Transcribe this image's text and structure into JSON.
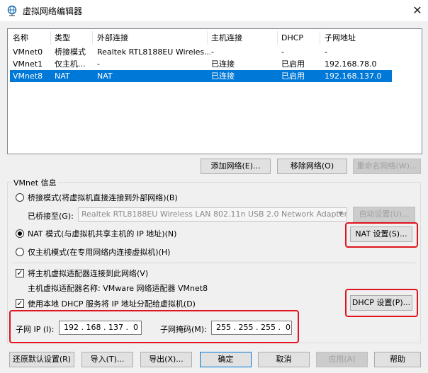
{
  "window": {
    "title": "虚拟网络编辑器",
    "close_symbol": "✕"
  },
  "table": {
    "headers": [
      "名称",
      "类型",
      "外部连接",
      "主机连接",
      "DHCP",
      "子网地址"
    ],
    "rows": [
      [
        "VMnet0",
        "桥接模式",
        "Realtek RTL8188EU Wireles...",
        "-",
        "-",
        "-"
      ],
      [
        "VMnet1",
        "仅主机...",
        "-",
        "已连接",
        "已启用",
        "192.168.78.0"
      ],
      [
        "VMnet8",
        "NAT",
        "NAT",
        "已连接",
        "已启用",
        "192.168.137.0"
      ]
    ],
    "selected_row": 2
  },
  "network_buttons": {
    "add": "添加网络(E)...",
    "remove": "移除网络(O)",
    "rename": "重命名网络(W)..."
  },
  "vmnet_info": {
    "label": "VMnet 信息",
    "bridge_radio": "桥接模式(将虚拟机直接连接到外部网络)(B)",
    "bridged_to_label": "已桥接至(G):",
    "bridged_to_value": "Realtek RTL8188EU Wireless LAN 802.11n USB 2.0 Network Adapter",
    "auto_settings": "自动设置(U)...",
    "nat_radio": "NAT 模式(与虚拟机共享主机的 IP 地址)(N)",
    "nat_settings": "NAT 设置(S)...",
    "hostonly_radio": "仅主机模式(在专用网络内连接虚拟机)(H)",
    "connect_adapter_check": "将主机虚拟适配器连接到此网络(V)",
    "adapter_name_label": "主机虚拟适配器名称: VMware 网络适配器 VMnet8",
    "dhcp_check": "使用本地 DHCP 服务将 IP 地址分配给虚拟机(D)",
    "dhcp_settings": "DHCP 设置(P)...",
    "check_mark": "✓",
    "subnet_ip_label": "子网 IP (I):",
    "subnet_ip_value": "192 . 168 . 137 .  0",
    "subnet_mask_label": "子网掩码(M):",
    "subnet_mask_value": "255 . 255 . 255 .  0"
  },
  "bottom_buttons": {
    "restore": "还原默认设置(R)",
    "import": "导入(T)...",
    "export": "导出(X)...",
    "ok": "确定",
    "cancel": "取消",
    "apply": "应用(A)",
    "help": "帮助"
  },
  "colors": {
    "selection": "#0078d7",
    "highlight_red": "#e0141e",
    "default_button_border": "#0078d7"
  }
}
